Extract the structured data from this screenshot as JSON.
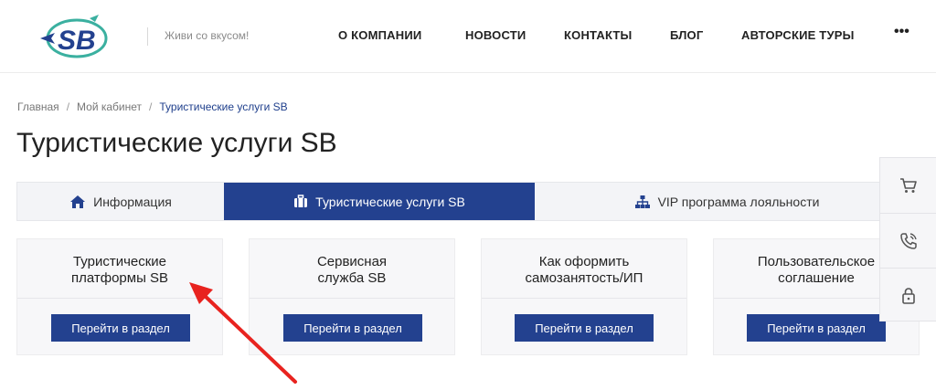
{
  "header": {
    "logo_text": "SB",
    "slogan": "Живи со вкусом!",
    "nav": [
      {
        "label": "О КОМПАНИИ"
      },
      {
        "label": "НОВОСТИ"
      },
      {
        "label": "КОНТАКТЫ"
      },
      {
        "label": "БЛОГ"
      },
      {
        "label": "АВТОРСКИЕ ТУРЫ"
      }
    ],
    "more_label": "•••"
  },
  "breadcrumb": {
    "items": [
      "Главная",
      "Мой кабинет",
      "Туристические услуги SB"
    ],
    "separator": "/"
  },
  "page_title": "Туристические услуги SB",
  "tabs": [
    {
      "label": "Информация",
      "icon": "home-icon",
      "active": false
    },
    {
      "label": "Туристические услуги SB",
      "icon": "suitcase-icon",
      "active": true
    },
    {
      "label": "VIP программа лояльности",
      "icon": "sitemap-icon",
      "active": false
    }
  ],
  "cards": [
    {
      "title": "Туристические\nплатформы SB",
      "button": "Перейти в раздел"
    },
    {
      "title": "Сервисная\nслужба SB",
      "button": "Перейти в раздел"
    },
    {
      "title": "Как оформить\nсамозанятость/ИП",
      "button": "Перейти в раздел"
    },
    {
      "title": "Пользовательское\nсоглашение",
      "button": "Перейти в раздел"
    }
  ],
  "side_widgets": [
    {
      "icon": "cart-icon"
    },
    {
      "icon": "phone-callback-icon"
    },
    {
      "icon": "lock-icon"
    }
  ],
  "colors": {
    "accent": "#23418f",
    "annotation_arrow": "#e8231f"
  }
}
